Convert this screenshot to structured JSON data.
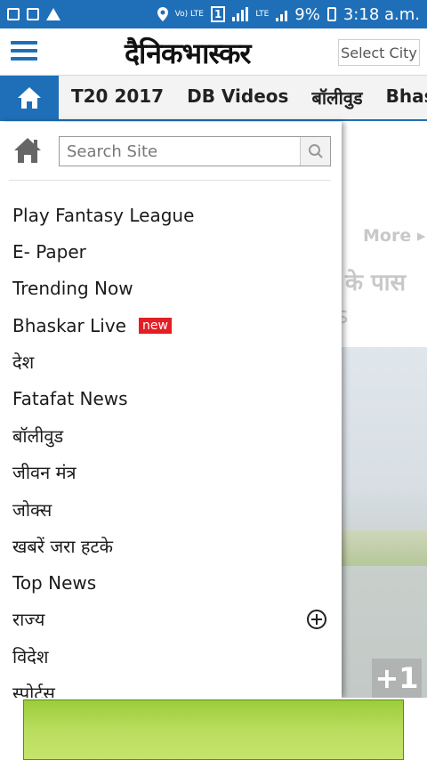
{
  "status_bar": {
    "battery_percent": "9%",
    "time": "3:18 a.m.",
    "network_label": "LTE",
    "volte_label": "Vo) LTE",
    "sim_label": "1"
  },
  "header": {
    "brand": "दैनिकभास्कर",
    "select_city": "Select City"
  },
  "nav": {
    "items": [
      "T20 2017",
      "DB Videos",
      "बॉलीवुड",
      "Bhask"
    ]
  },
  "drawer": {
    "search_placeholder": "Search Site",
    "menu": [
      {
        "label": "Play Fantasy League"
      },
      {
        "label": "E- Paper"
      },
      {
        "label": "Trending Now"
      },
      {
        "label": "Bhaskar Live",
        "badge": "new"
      },
      {
        "label": "देश"
      },
      {
        "label": "Fatafat News"
      },
      {
        "label": "बॉलीवुड"
      },
      {
        "label": "जीवन मंत्र"
      },
      {
        "label": "जोक्स"
      },
      {
        "label": "खबरें जरा हटके"
      },
      {
        "label": "Top News"
      },
      {
        "label": "राज्य",
        "expandable": true
      },
      {
        "label": "विदेश"
      },
      {
        "label": "स्पोर्ट्स"
      }
    ]
  },
  "background": {
    "more_link": "More ▸",
    "headline_fragment": "के पास",
    "headline_fragment2": "s",
    "image_badge": "+1"
  },
  "colors": {
    "primary": "#1f6fb8",
    "badge_red": "#e31e24",
    "ad_green": "#a6d24a"
  }
}
